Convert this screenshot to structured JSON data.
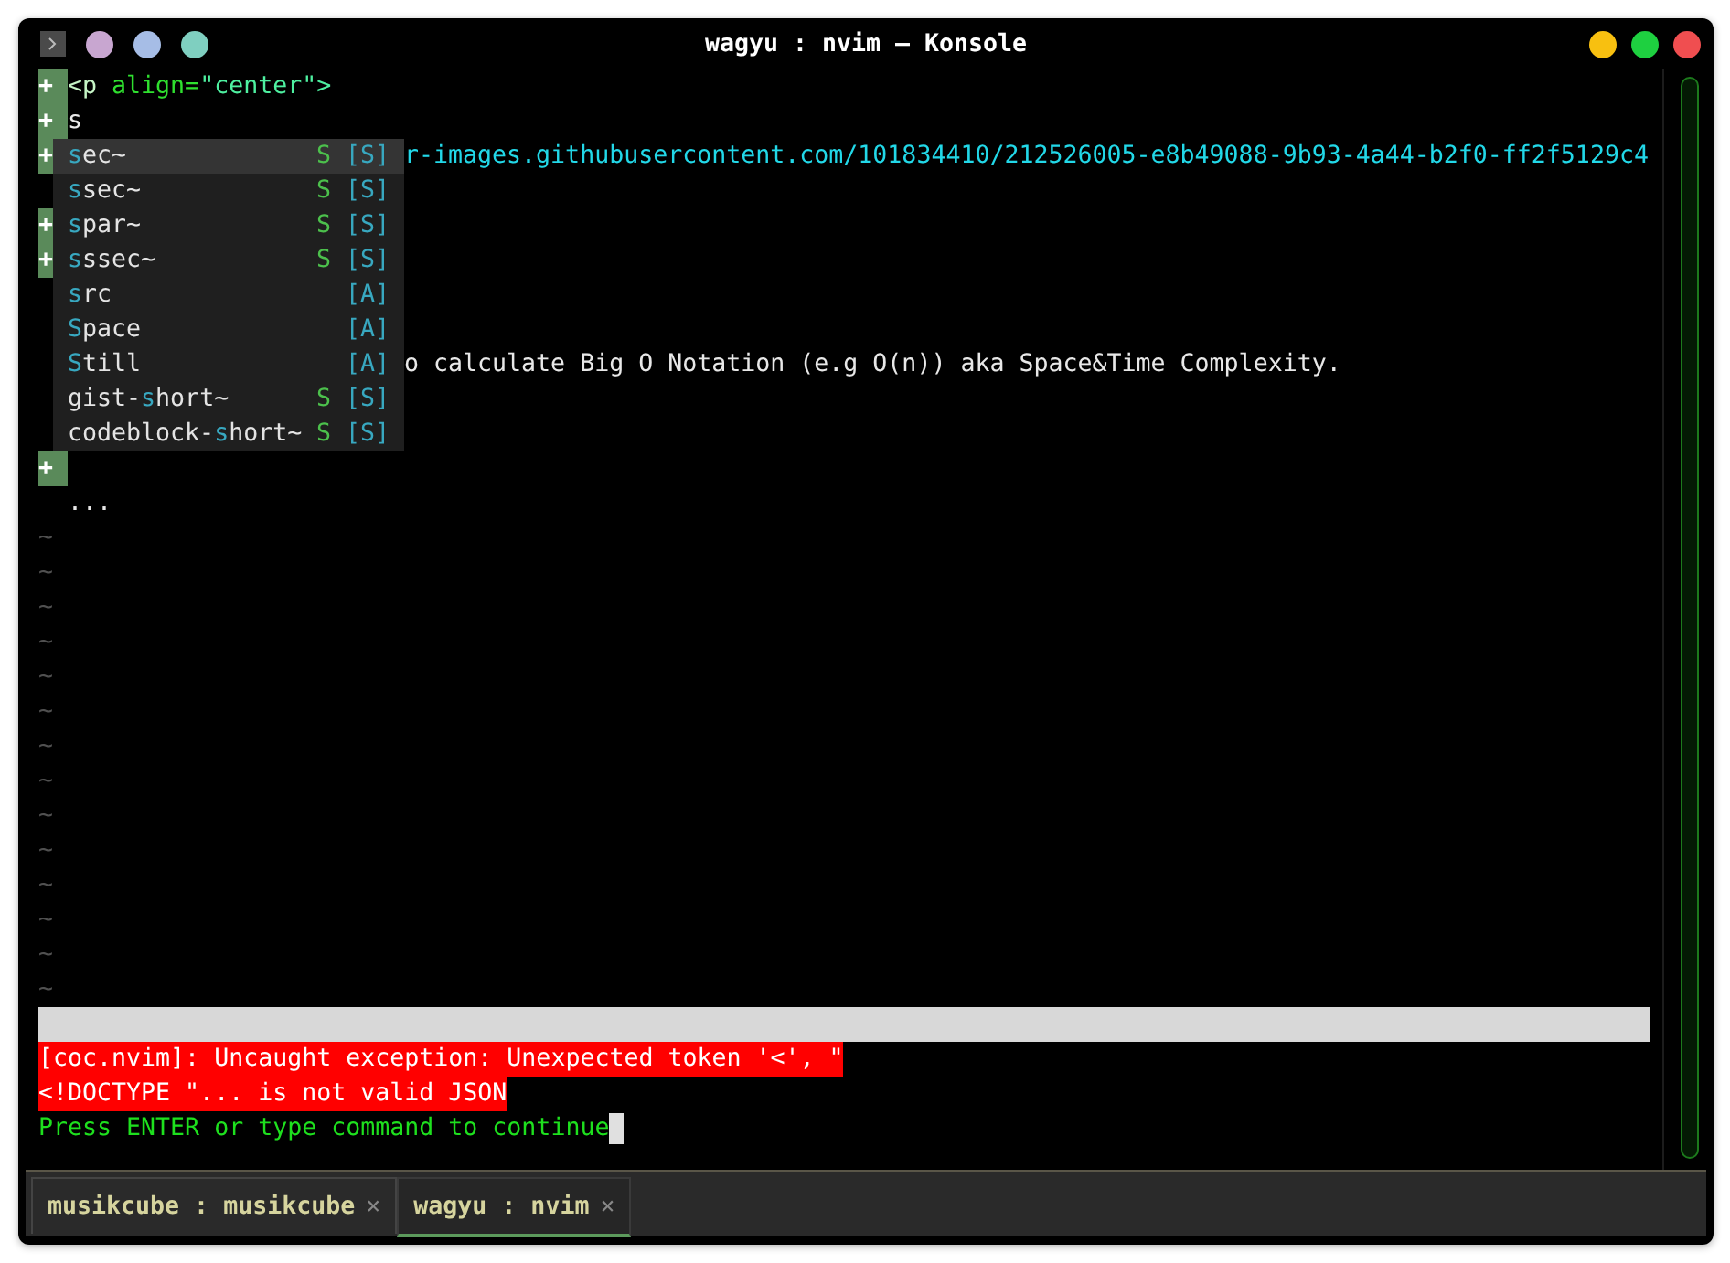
{
  "window": {
    "title": "wagyu : nvim — Konsole"
  },
  "buffer": [
    {
      "added": true,
      "sign": "+",
      "segments": [
        {
          "kind": "tag",
          "text": "<p "
        },
        {
          "kind": "attr",
          "text": "align="
        },
        {
          "kind": "string",
          "text": "\"center\">"
        }
      ]
    },
    {
      "added": true,
      "sign": "+",
      "segments": [
        {
          "kind": "plain",
          "text": "s"
        }
      ]
    },
    {
      "added": true,
      "sign": "+",
      "segments": [
        {
          "kind": "url",
          "text": "r-images.githubusercontent.com/101834410/212526005-e8b49088-9b93-4a44-b2f0-ff2f5129c4"
        }
      ]
    },
    {
      "added": false
    },
    {
      "added": true,
      "sign": "+"
    },
    {
      "added": true,
      "sign": "+"
    },
    {
      "added": false
    },
    {
      "added": false
    },
    {
      "added": false,
      "segments": [
        {
          "kind": "plain",
          "text": "o calculate Big O Notation (e.g O(n)) aka Space&Time Complexity."
        }
      ]
    },
    {
      "added": false
    },
    {
      "added": false
    },
    {
      "added": true,
      "sign": "+"
    },
    {
      "added": false,
      "segments": [
        {
          "kind": "plain",
          "text": "..."
        }
      ]
    }
  ],
  "empty_lines": [
    "~",
    "~",
    "~",
    "~",
    "~",
    "~",
    "~",
    "~",
    "~",
    "~",
    "~",
    "~",
    "~",
    "~"
  ],
  "completion_menu": [
    {
      "selected": true,
      "match": "s",
      "suffix": "ec~",
      "kind_label": "S",
      "menu": "[S]"
    },
    {
      "selected": false,
      "match": "s",
      "suffix": "sec~",
      "kind_label": "S",
      "menu": "[S]"
    },
    {
      "selected": false,
      "match": "s",
      "suffix": "par~",
      "kind_label": "S",
      "menu": "[S]"
    },
    {
      "selected": false,
      "match": "s",
      "suffix": "ssec~",
      "kind_label": "S",
      "menu": "[S]"
    },
    {
      "selected": false,
      "match": "s",
      "suffix": "rc",
      "menu": "[A]"
    },
    {
      "selected": false,
      "match": "S",
      "suffix": "pace",
      "menu": "[A]"
    },
    {
      "selected": false,
      "match": "S",
      "suffix": "till",
      "menu": "[A]"
    },
    {
      "selected": false,
      "prefix": "gist-",
      "match": "s",
      "suffix": "hort~",
      "kind_label": "S",
      "menu": "[S]"
    },
    {
      "selected": false,
      "prefix": "codeblock-",
      "match": "s",
      "suffix": "hort~",
      "kind_label": "S",
      "menu": "[S]"
    }
  ],
  "messages": [
    {
      "kind": "error",
      "text": "[coc.nvim]: Uncaught exception: Unexpected token '<', \""
    },
    {
      "kind": "error",
      "text": "<!DOCTYPE \"... is not valid JSON"
    },
    {
      "kind": "prompt",
      "text": "Press ENTER or type command to continue",
      "cursor": true
    }
  ],
  "tabs": [
    {
      "label": "musikcube : musikcube",
      "close": "×",
      "selected": false
    },
    {
      "label": "wagyu : nvim",
      "close": "×",
      "selected": true
    }
  ]
}
